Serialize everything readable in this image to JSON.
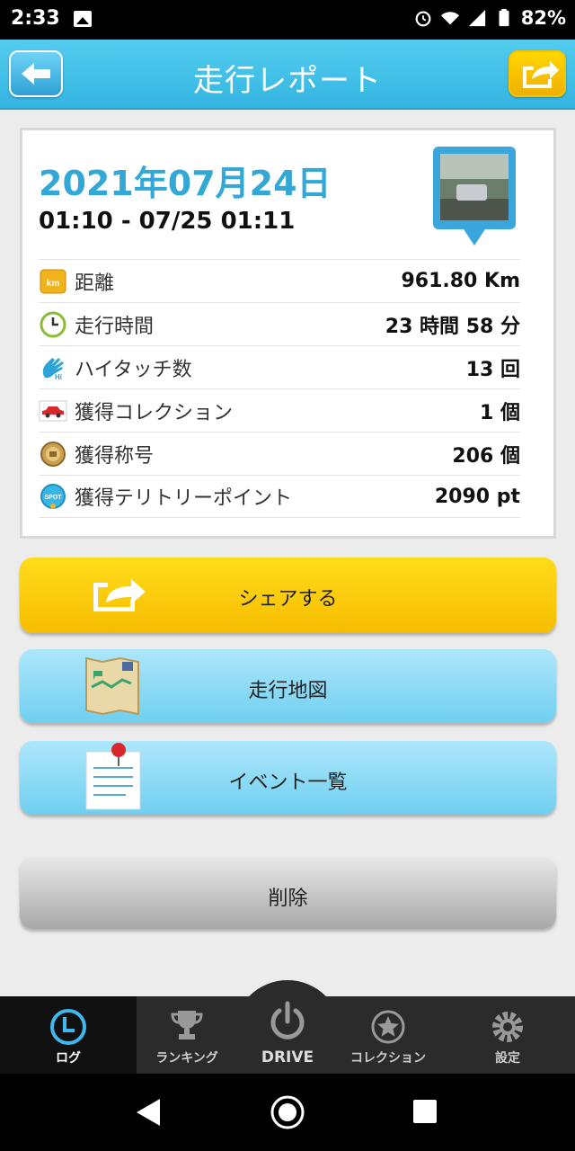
{
  "status_bar": {
    "time": "2:33",
    "battery": "82%"
  },
  "header": {
    "title": "走行レポート"
  },
  "report": {
    "date": "2021年07月24日",
    "time_range": "01:10 - 07/25 01:11",
    "rows": [
      {
        "icon": "km-icon",
        "label": "距離",
        "value": "961.80 Km"
      },
      {
        "icon": "clock-icon",
        "label": "走行時間",
        "value": "23 時間 58 分"
      },
      {
        "icon": "hi-five-icon",
        "label": "ハイタッチ数",
        "value": "13 回"
      },
      {
        "icon": "car-icon",
        "label": "獲得コレクション",
        "value": "1 個"
      },
      {
        "icon": "medal-icon",
        "label": "獲得称号",
        "value": "206 個"
      },
      {
        "icon": "spot-icon",
        "label": "獲得テリトリーポイント",
        "value": "2090 pt"
      }
    ]
  },
  "buttons": {
    "share": "シェアする",
    "map": "走行地図",
    "events": "イベント一覧",
    "delete": "削除"
  },
  "tabs": [
    {
      "label": "ログ",
      "active": true
    },
    {
      "label": "ランキング"
    },
    {
      "label": "DRIVE"
    },
    {
      "label": "コレクション"
    },
    {
      "label": "設定"
    }
  ],
  "colors": {
    "accent_blue": "#33b5e0",
    "share_yellow": "#f6bd00",
    "date_blue": "#33a8d6"
  }
}
